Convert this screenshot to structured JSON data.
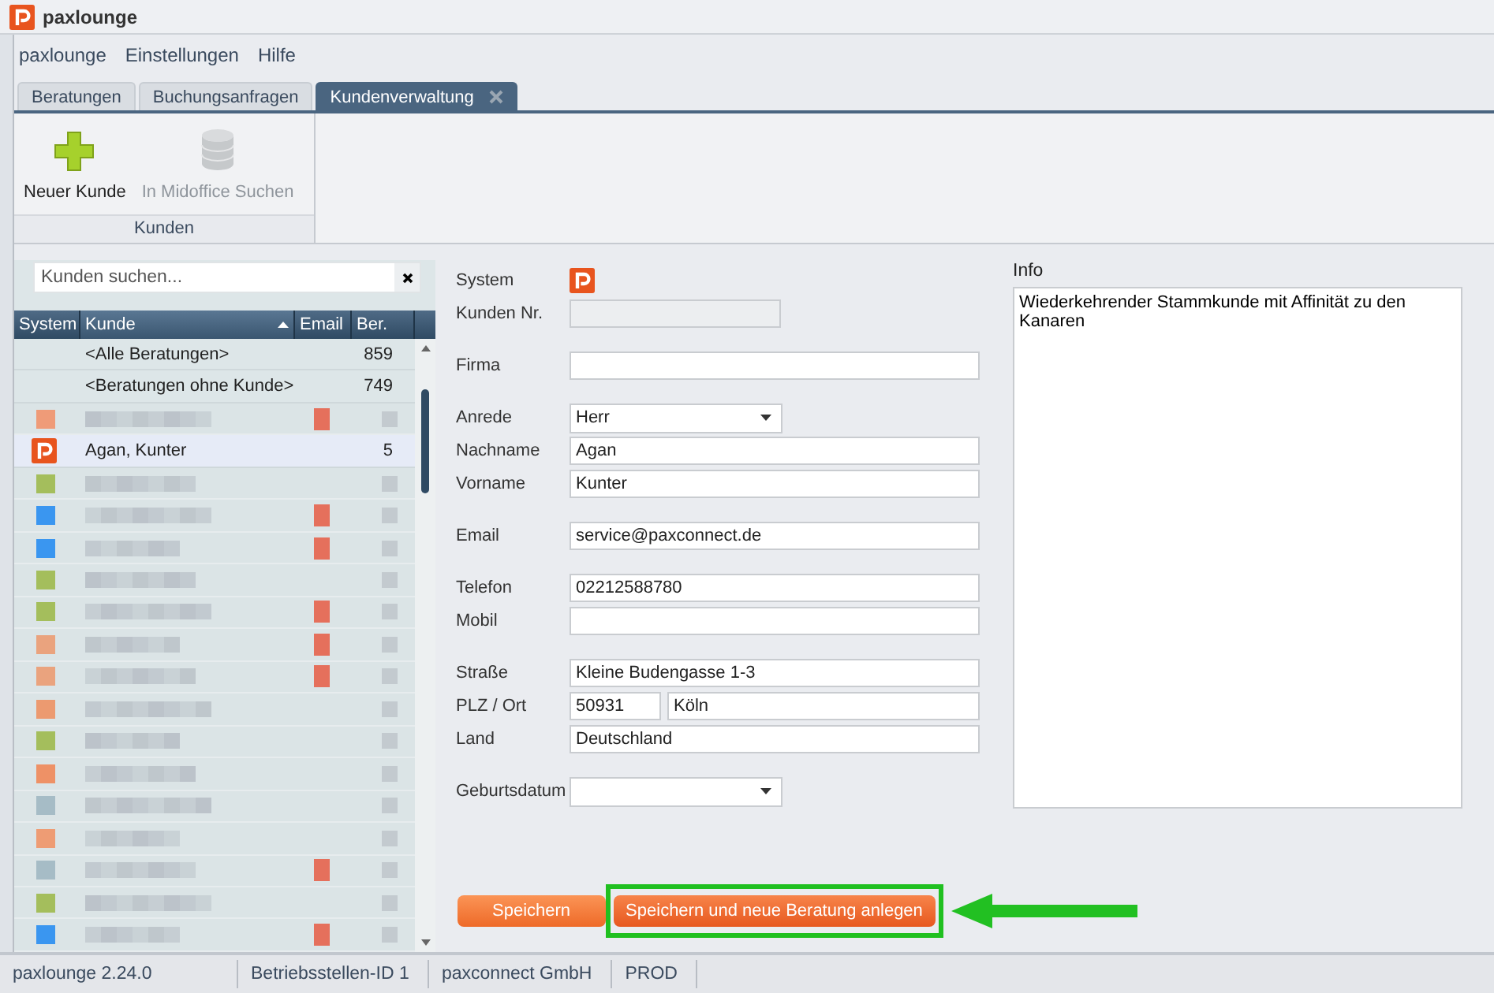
{
  "window": {
    "title": "paxlounge"
  },
  "menu": [
    {
      "label": "paxlounge"
    },
    {
      "label": "Einstellungen"
    },
    {
      "label": "Hilfe"
    }
  ],
  "tabs": [
    {
      "label": "Beratungen",
      "selected": false,
      "closable": false
    },
    {
      "label": "Buchungsanfragen",
      "selected": false,
      "closable": false
    },
    {
      "label": "Kundenverwaltung",
      "selected": true,
      "closable": true
    }
  ],
  "ribbon": {
    "group": "Kunden",
    "buttons": [
      {
        "label": "Neuer Kunde",
        "kind": "add",
        "disabled": false
      },
      {
        "label": "In Midoffice Suchen",
        "kind": "database",
        "disabled": true
      }
    ]
  },
  "customer_list": {
    "search": {
      "placeholder": "Kunden suchen..."
    },
    "columns": [
      {
        "label": "System",
        "sorted": false
      },
      {
        "label": "Kunde",
        "sorted": true
      },
      {
        "label": "Email",
        "sorted": false
      },
      {
        "label": "Ber.",
        "sorted": false
      }
    ],
    "rows": [
      {
        "kind": "special",
        "name": "<Alle Beratungen>",
        "count": "859",
        "selected": false
      },
      {
        "kind": "special",
        "name": "<Beratungen ohne Kunde>",
        "count": "749",
        "selected": false
      },
      {
        "kind": "blurred",
        "color": "#ef9b78",
        "has_email": true,
        "selected": false
      },
      {
        "kind": "customer",
        "name": "Agan, Kunter",
        "count": "5",
        "selected": true
      },
      {
        "kind": "blurred",
        "color": "#a4be5c",
        "has_email": false,
        "selected": false
      },
      {
        "kind": "blurred",
        "color": "#3a96f0",
        "has_email": true,
        "selected": false
      },
      {
        "kind": "blurred",
        "color": "#3a96f0",
        "has_email": true,
        "selected": false
      },
      {
        "kind": "blurred",
        "color": "#a4be5c",
        "has_email": false,
        "selected": false
      },
      {
        "kind": "blurred",
        "color": "#a4be5c",
        "has_email": true,
        "selected": false
      },
      {
        "kind": "blurred",
        "color": "#eaa37e",
        "has_email": true,
        "selected": false
      },
      {
        "kind": "blurred",
        "color": "#eaa37e",
        "has_email": true,
        "selected": false
      },
      {
        "kind": "blurred",
        "color": "#ec9a70",
        "has_email": false,
        "selected": false
      },
      {
        "kind": "blurred",
        "color": "#a4be5c",
        "has_email": false,
        "selected": false
      },
      {
        "kind": "blurred",
        "color": "#ee9166",
        "has_email": false,
        "selected": false
      },
      {
        "kind": "blurred",
        "color": "#a6bcc6",
        "has_email": false,
        "selected": false
      },
      {
        "kind": "blurred",
        "color": "#ee9c74",
        "has_email": false,
        "selected": false
      },
      {
        "kind": "blurred",
        "color": "#a6bcc6",
        "has_email": true,
        "selected": false
      },
      {
        "kind": "blurred",
        "color": "#a4be5c",
        "has_email": false,
        "selected": false
      },
      {
        "kind": "blurred",
        "color": "#3a96f0",
        "has_email": true,
        "selected": false
      }
    ]
  },
  "form": {
    "groups": [
      [
        {
          "label": "System",
          "kind": "logo"
        },
        {
          "label": "Kunden Nr.",
          "kind": "text",
          "disabled": true
        }
      ],
      [
        {
          "label": "Firma",
          "kind": "text",
          "disabled": false
        }
      ],
      [
        {
          "label": "Anrede",
          "kind": "select",
          "value": "Herr"
        },
        {
          "label": "Nachname",
          "kind": "text",
          "value": "Agan",
          "disabled": false
        },
        {
          "label": "Vorname",
          "kind": "text",
          "value": "Kunter",
          "disabled": false
        }
      ],
      [
        {
          "label": "Email",
          "kind": "text",
          "value": "service@paxconnect.de",
          "disabled": false
        }
      ],
      [
        {
          "label": "Telefon",
          "kind": "text",
          "value": "02212588780",
          "disabled": false
        },
        {
          "label": "Mobil",
          "kind": "text",
          "disabled": false
        }
      ],
      [
        {
          "label": "Straße",
          "kind": "text",
          "value": "Kleine Budengasse 1-3",
          "disabled": false
        },
        {
          "label": "PLZ / Ort",
          "kind": "zip-city",
          "zip": "50931",
          "city": "Köln"
        },
        {
          "label": "Land",
          "kind": "text",
          "value": "Deutschland",
          "disabled": false
        }
      ],
      [
        {
          "label": "Geburtsdatum",
          "kind": "select"
        }
      ]
    ],
    "info": {
      "label": "Info",
      "value": "Wiederkehrender Stammkunde mit Affinität zu den Kanaren"
    },
    "buttons": [
      {
        "label": "Speichern",
        "highlighted": false
      },
      {
        "label": "Speichern und neue Beratung anlegen",
        "highlighted": true
      }
    ]
  },
  "status_bar": [
    {
      "text": "paxlounge 2.24.0"
    },
    {
      "text": "Betriebsstellen-ID 1"
    },
    {
      "text": "paxconnect GmbH"
    },
    {
      "text": "PROD"
    }
  ]
}
